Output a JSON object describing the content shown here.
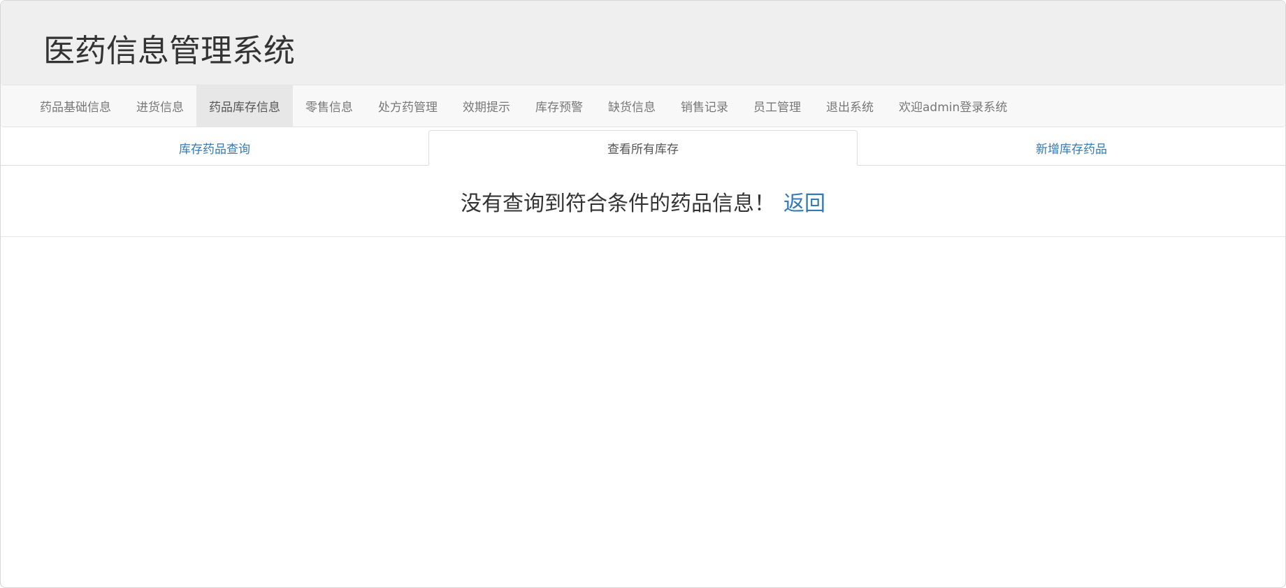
{
  "header": {
    "title": "医药信息管理系统"
  },
  "navbar": {
    "items": [
      {
        "label": "药品基础信息"
      },
      {
        "label": "进货信息"
      },
      {
        "label": "药品库存信息"
      },
      {
        "label": "零售信息"
      },
      {
        "label": "处方药管理"
      },
      {
        "label": "效期提示"
      },
      {
        "label": "库存预警"
      },
      {
        "label": "缺货信息"
      },
      {
        "label": "销售记录"
      },
      {
        "label": "员工管理"
      },
      {
        "label": "退出系统"
      },
      {
        "label": "欢迎admin登录系统"
      }
    ],
    "active_index": 2
  },
  "tabs": [
    {
      "label": "库存药品查询"
    },
    {
      "label": "查看所有库存"
    },
    {
      "label": "新增库存药品"
    }
  ],
  "main": {
    "message": "没有查询到符合条件的药品信息！",
    "back_link": "返回"
  },
  "colors": {
    "link": "#337ab7",
    "header_bg": "#efefef",
    "navbar_bg": "#f8f8f8",
    "nav_active_bg": "#e7e7e7"
  }
}
